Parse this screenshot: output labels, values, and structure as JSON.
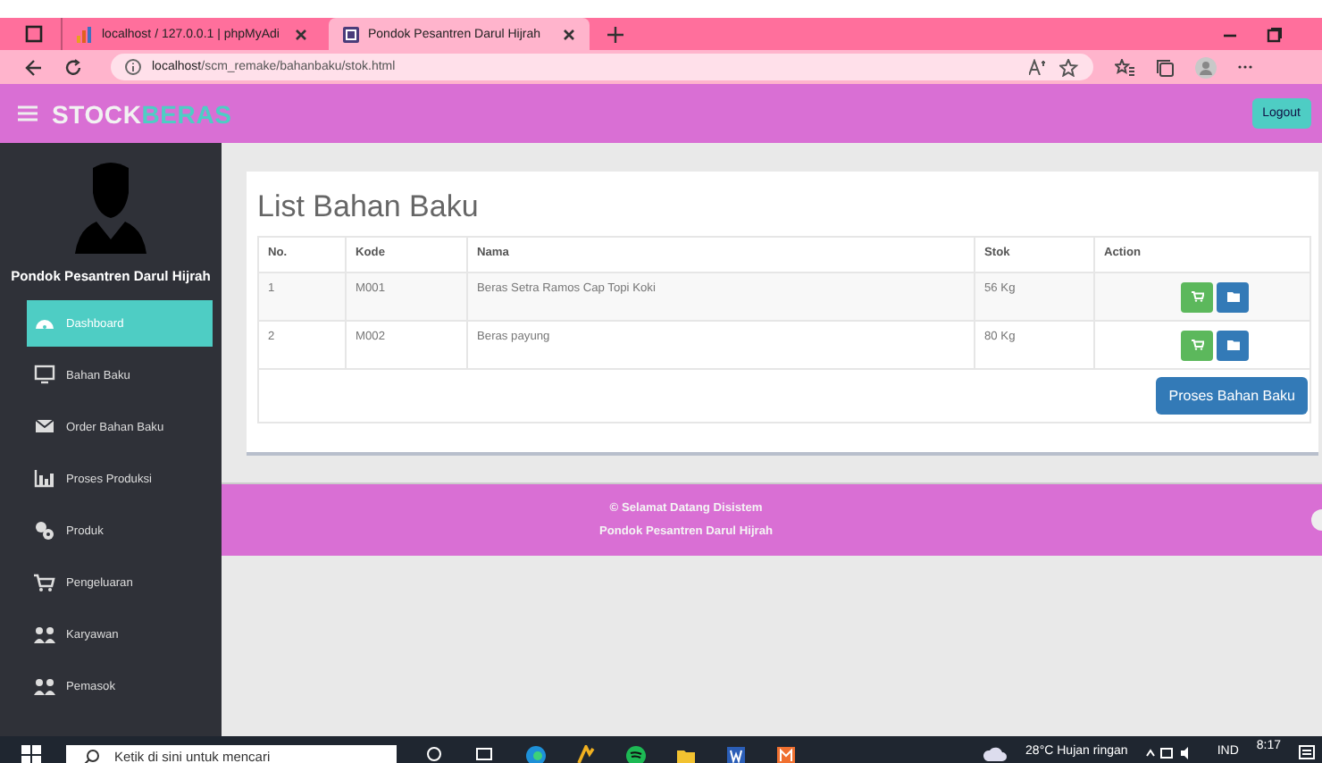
{
  "browser": {
    "tabs": [
      {
        "label": "localhost / 127.0.0.1 | phpMyAdi",
        "selected": false
      },
      {
        "label": "Pondok Pesantren Darul Hijrah",
        "selected": true
      }
    ],
    "address": {
      "host": "localhost",
      "path": "/scm_remake/bahanbaku/stok.html"
    }
  },
  "header": {
    "logo_main": "STOCK",
    "logo_accent": "BERAS",
    "logout": "Logout"
  },
  "sidebar": {
    "user_name": "Pondok Pesantren Darul Hijrah",
    "items": [
      {
        "label": "Dashboard",
        "selected": true
      },
      {
        "label": "Bahan Baku",
        "selected": false
      },
      {
        "label": "Order Bahan Baku",
        "selected": false
      },
      {
        "label": "Proses Produksi",
        "selected": false
      },
      {
        "label": "Produk",
        "selected": false
      },
      {
        "label": "Pengeluaran",
        "selected": false
      },
      {
        "label": "Karyawan",
        "selected": false
      },
      {
        "label": "Pemasok",
        "selected": false
      }
    ]
  },
  "content": {
    "title": "List Bahan Baku",
    "table": {
      "columns": [
        "No.",
        "Kode",
        "Nama",
        "Stok",
        "Action"
      ],
      "rows": [
        [
          "1",
          "M001",
          "Beras Setra Ramos Cap Topi Koki",
          "56 Kg"
        ],
        [
          "2",
          "M002",
          "Beras payung",
          "80 Kg"
        ]
      ]
    },
    "process_button": "Proses Bahan Baku"
  },
  "footer": {
    "lines": [
      "© Selamat Datang Disistem",
      "Pondok Pesantren Darul Hijrah"
    ]
  },
  "taskbar": {
    "search_placeholder": "Ketik di sini untuk mencari",
    "weather": "28°C  Hujan ringan",
    "language": "IND",
    "time": "8:17"
  }
}
